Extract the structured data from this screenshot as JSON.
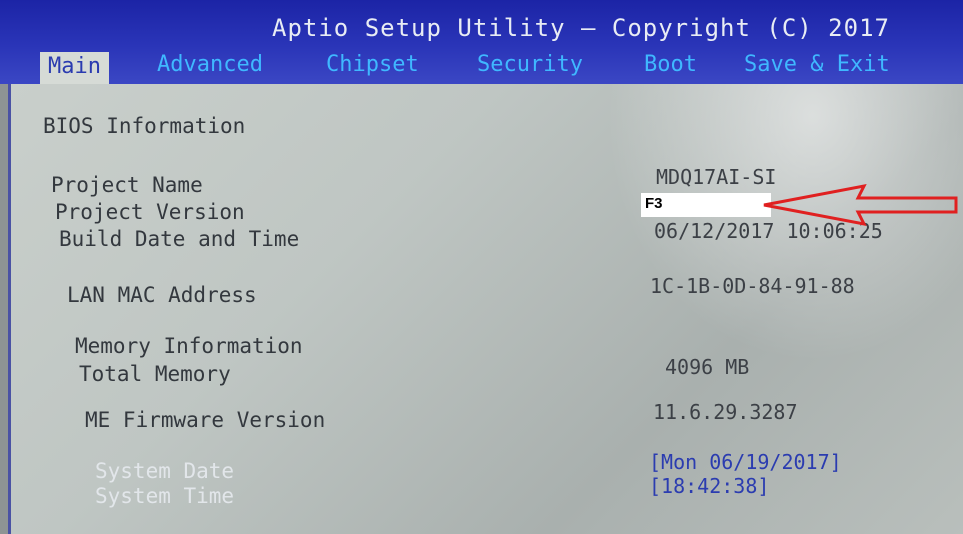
{
  "header": {
    "title": "Aptio Setup Utility – Copyright (C) 2017",
    "tabs": [
      "Main",
      "Advanced",
      "Chipset",
      "Security",
      "Boot",
      "Save & Exit"
    ]
  },
  "main": {
    "section_title": "BIOS Information",
    "rows": {
      "project_name": {
        "label": "Project Name",
        "value": "MDQ17AI-SI"
      },
      "project_version": {
        "label": "Project Version",
        "value": "F3"
      },
      "build_date": {
        "label": "Build Date and Time",
        "value": "06/12/2017 10:06:25"
      },
      "lan_mac": {
        "label": "LAN MAC Address",
        "value": "1C-1B-0D-84-91-88"
      },
      "memory_info": {
        "label": "Memory Information"
      },
      "total_memory": {
        "label": "Total Memory",
        "value": "4096 MB"
      },
      "me_firmware": {
        "label": "ME Firmware Version",
        "value": "11.6.29.3287"
      },
      "system_date": {
        "label": "System Date",
        "value": "[Mon 06/19/2017]"
      },
      "system_time": {
        "label": "System Time",
        "value": "[18:42:38]"
      }
    }
  },
  "annotation": {
    "arrow_color": "#e02020",
    "icon": "red-arrow-icon"
  }
}
